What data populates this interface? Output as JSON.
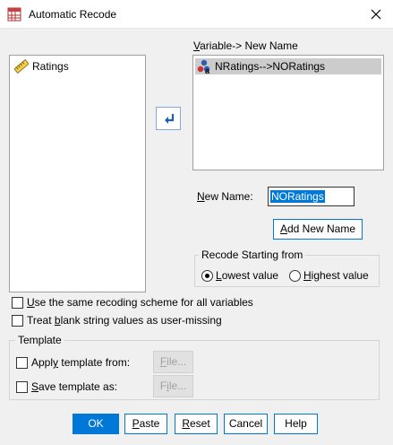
{
  "window": {
    "title": "Automatic Recode",
    "icons": {
      "app": "recode-app-icon",
      "close": "close-icon"
    }
  },
  "source_list": {
    "items": [
      {
        "label": "Ratings",
        "icon": "scale-variable-icon"
      }
    ]
  },
  "move_button": {
    "icon": "arrow-left-icon"
  },
  "target_list": {
    "header_pre": "V",
    "header_post": "ariable-> New Name",
    "items": [
      {
        "label": "NRatings-->NORatings",
        "icon": "nominal-string-variable-icon"
      }
    ]
  },
  "new_name": {
    "label_pre": "N",
    "label_post": "ew Name:",
    "value": "NORatings"
  },
  "add_new_name_button": {
    "pre": "",
    "ul": "A",
    "post": "dd New Name"
  },
  "recode_start": {
    "title": "Recode Starting from",
    "lowest": {
      "pre": "",
      "ul": "L",
      "post": "owest value",
      "checked": true
    },
    "highest": {
      "pre": "",
      "ul": "H",
      "post": "ighest value",
      "checked": false
    }
  },
  "options": {
    "same_scheme": {
      "pre": "",
      "ul": "U",
      "post": "se the same recoding scheme for all variables",
      "checked": false
    },
    "blank_missing": {
      "pre": "Treat ",
      "ul": "b",
      "post": "lank string values as user-missing",
      "checked": false
    }
  },
  "template": {
    "title": "Template",
    "apply": {
      "pre": "Appl",
      "ul": "y",
      "post": " template from:",
      "checked": false
    },
    "save": {
      "pre": "",
      "ul": "S",
      "post": "ave template as:",
      "checked": false
    },
    "file_button_1": {
      "pre": "",
      "ul": "F",
      "post": "ile..."
    },
    "file_button_2": {
      "pre": "F",
      "ul": "i",
      "post": "le..."
    }
  },
  "buttons": {
    "ok": "OK",
    "paste": {
      "pre": "",
      "ul": "P",
      "post": "aste"
    },
    "reset": {
      "pre": "",
      "ul": "R",
      "post": "eset"
    },
    "cancel": "Cancel",
    "help": "Help"
  },
  "colors": {
    "accent": "#0078d7",
    "selection": "#cccccc"
  }
}
